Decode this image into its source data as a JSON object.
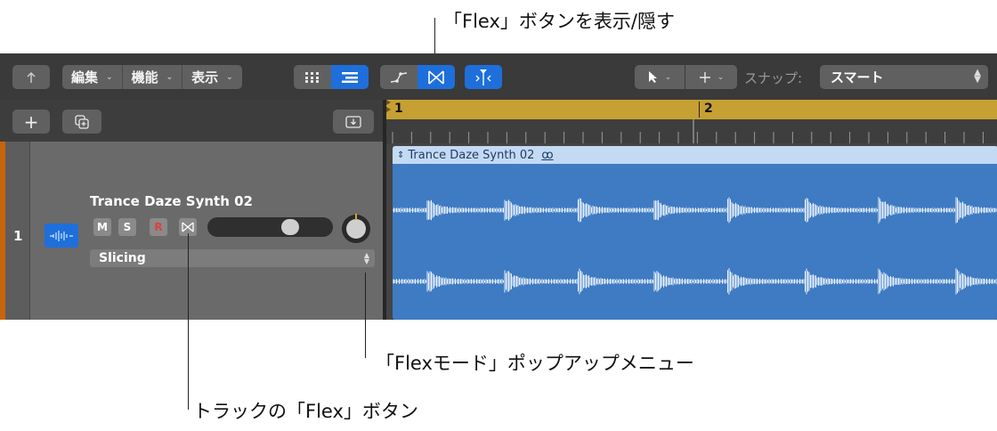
{
  "callouts": {
    "show_flex_button": "「Flex」ボタンを表示/隠す",
    "flex_mode_popup": "「Flexモード」ポップアップメニュー",
    "track_flex_button": "トラックの「Flex」ボタン"
  },
  "toolbar": {
    "menus": [
      {
        "label": "編集"
      },
      {
        "label": "機能"
      },
      {
        "label": "表示"
      }
    ],
    "snap_label": "スナップ:",
    "snap_value": "スマート"
  },
  "track": {
    "number": "1",
    "name": "Trance Daze Synth 02",
    "mute_label": "M",
    "solo_label": "S",
    "record_label": "R",
    "flex_mode": "Slicing",
    "volume_level": 0.7
  },
  "timeline": {
    "bar_markers": [
      "1",
      "2"
    ]
  },
  "region": {
    "name": "Trance Daze Synth 02",
    "loop_symbol": "ꝏ"
  },
  "colors": {
    "accent": "#1e6fdc",
    "track_color": "#c7640c",
    "ruler": "#c6a033",
    "region": "#3f7bc2",
    "region_header": "#c4daf3"
  }
}
